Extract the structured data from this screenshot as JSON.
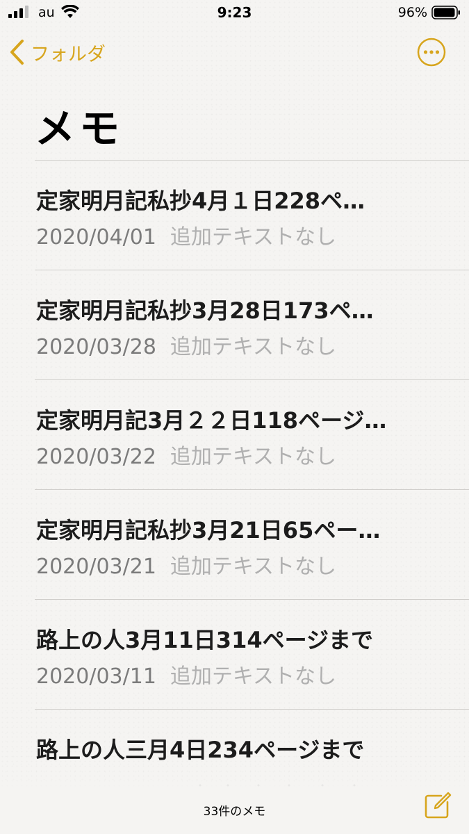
{
  "status_bar": {
    "carrier": "au",
    "time": "9:23",
    "battery_percent": "96%"
  },
  "nav": {
    "back_label": "フォルダ"
  },
  "page_title": "メモ",
  "notes": [
    {
      "title": "定家明月記私抄4月１日228ペ…",
      "date": "2020/04/01",
      "preview": "追加テキストなし"
    },
    {
      "title": "定家明月記私抄3月28日173ペ…",
      "date": "2020/03/28",
      "preview": "追加テキストなし"
    },
    {
      "title": "定家明月記3月２２日118ページ…",
      "date": "2020/03/22",
      "preview": "追加テキストなし"
    },
    {
      "title": "定家明月記私抄3月21日65ペー…",
      "date": "2020/03/21",
      "preview": "追加テキストなし"
    },
    {
      "title": "路上の人3月11日314ページまで",
      "date": "2020/03/11",
      "preview": "追加テキストなし"
    },
    {
      "title": "路上の人三月4日234ページまで"
    }
  ],
  "toolbar": {
    "note_count": "33件のメモ"
  },
  "colors": {
    "accent": "#d7a51d",
    "background": "#f5f4f2",
    "date_text": "#7b7b7b",
    "preview_text": "#b0b0b0"
  },
  "icons": {
    "signal": "cellular-signal-icon",
    "wifi": "wifi-icon",
    "battery": "battery-icon",
    "back": "chevron-left-icon",
    "more": "more-ellipsis-circle-icon",
    "compose": "compose-note-icon"
  }
}
